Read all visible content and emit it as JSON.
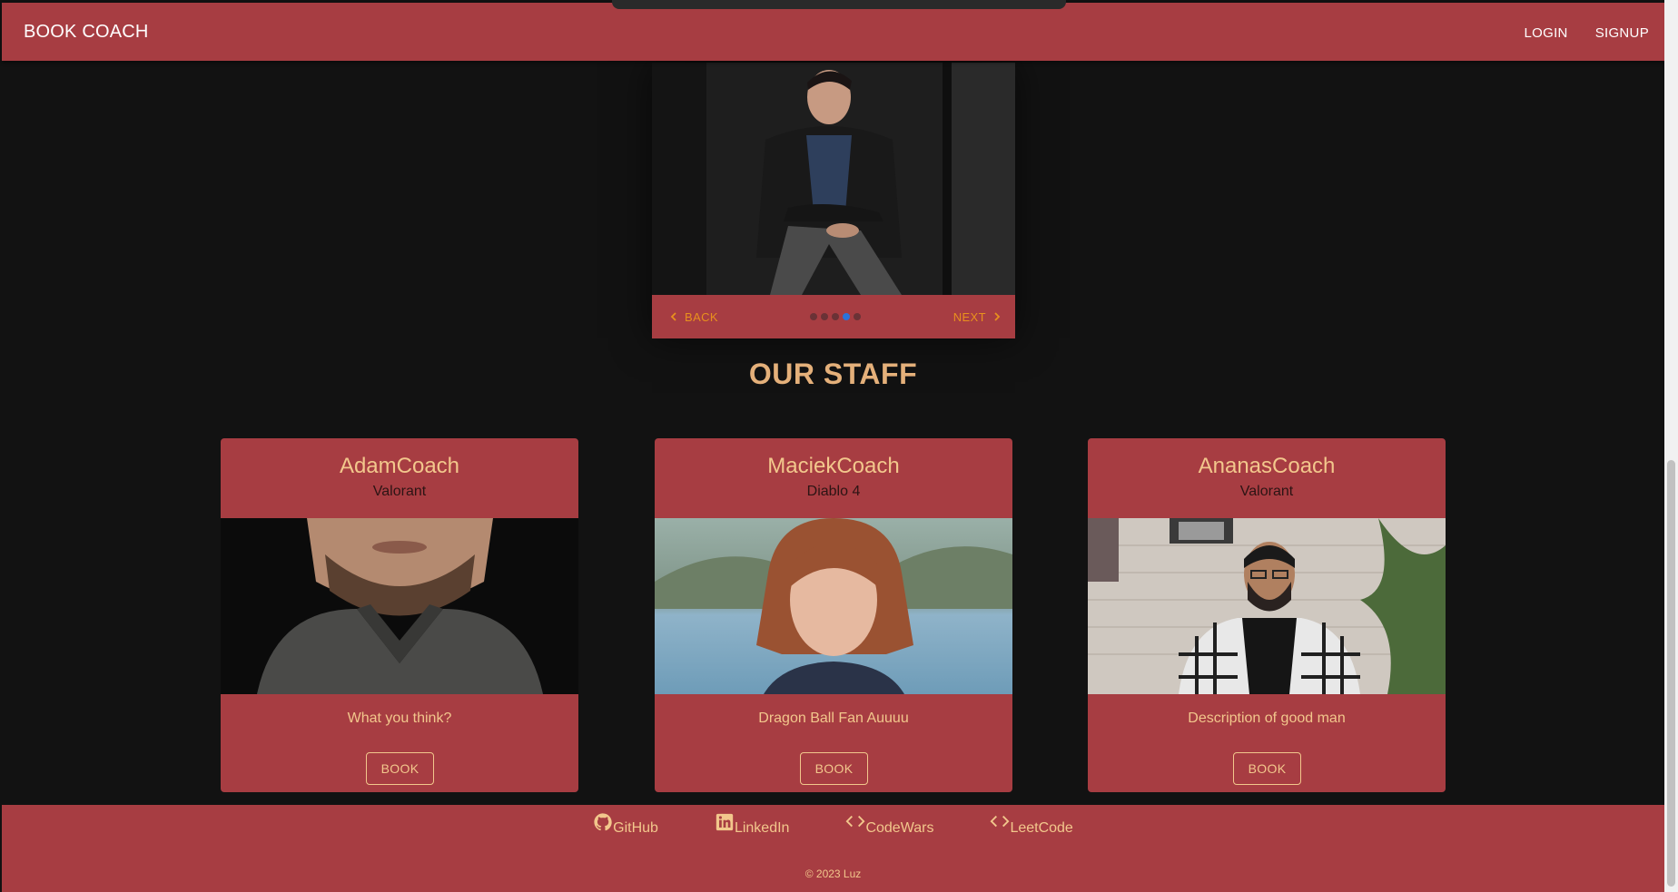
{
  "navbar": {
    "brand": "BOOK COACH",
    "login_label": "LOGIN",
    "signup_label": "SIGNUP"
  },
  "carousel": {
    "back_label": "BACK",
    "next_label": "NEXT",
    "active_step": 4,
    "total_steps": 5
  },
  "staff": {
    "title": "OUR STAFF",
    "coaches": [
      {
        "name": "AdamCoach",
        "game": "Valorant",
        "description": "What you think?",
        "book_label": "BOOK"
      },
      {
        "name": "MaciekCoach",
        "game": "Diablo 4",
        "description": "Dragon Ball Fan Auuuu",
        "book_label": "BOOK"
      },
      {
        "name": "AnanasCoach",
        "game": "Valorant",
        "description": "Description of good man",
        "book_label": "BOOK"
      }
    ]
  },
  "footer": {
    "links": [
      {
        "label": "GitHub",
        "icon": "github-icon"
      },
      {
        "label": "LinkedIn",
        "icon": "linkedin-icon"
      },
      {
        "label": "CodeWars",
        "icon": "code-icon"
      },
      {
        "label": "LeetCode",
        "icon": "code-icon"
      }
    ],
    "copyright": "© 2023 Luz"
  },
  "colors": {
    "primary": "#a73d42",
    "accent_text": "#f2c78c",
    "heading": "#e4b07a",
    "stepper_text": "#e8901e",
    "active_dot": "#2a73d9",
    "background": "#121212"
  }
}
